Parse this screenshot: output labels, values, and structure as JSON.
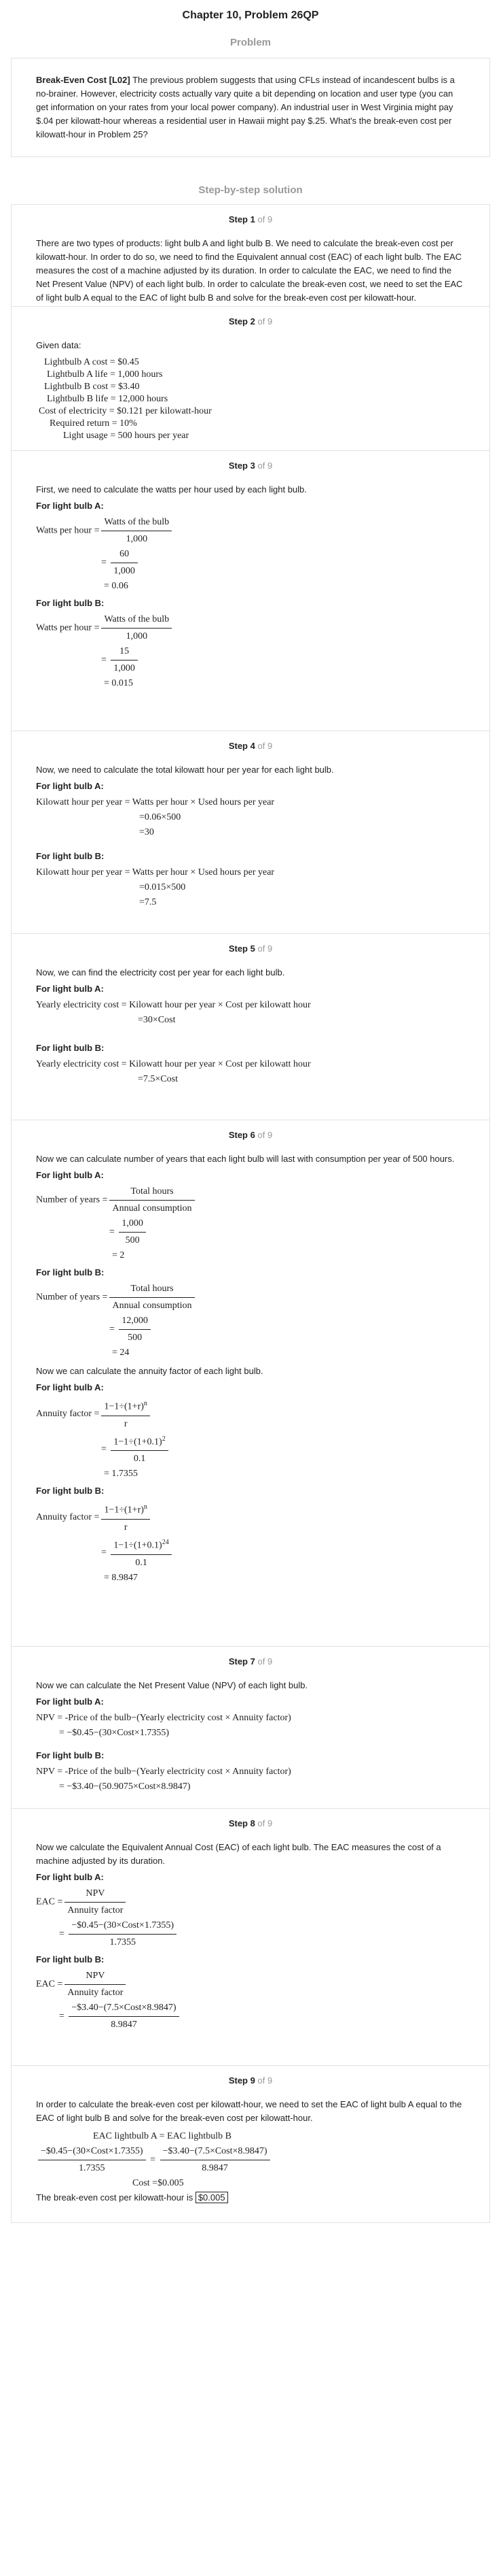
{
  "header": {
    "title": "Chapter 10, Problem 26QP"
  },
  "problem": {
    "section_label": "Problem",
    "bold_lead": "Break-Even Cost [L02]",
    "text": " The previous problem suggests that using CFLs instead of incandescent bulbs is a no-brainer. However, electricity costs actually vary quite a bit depending on location and user type (you can get information on your rates from your local power company). An industrial user in West Virginia might pay $.04 per kilowatt-hour whereas a residential user in Hawaii might pay $.25. What's the break-even cost per kilowatt-hour in Problem 25?"
  },
  "solution": {
    "section_label": "Step-by-step solution"
  },
  "step_word": "Step",
  "step_of": "of 9",
  "light_a": "For light bulb A:",
  "light_b": "For light bulb B:",
  "steps": {
    "s1": {
      "num": "1",
      "text": "There are two types of products: light bulb A and light bulb B. We need to calculate the break-even cost per kilowatt-hour. In order to do so, we need to find the Equivalent annual cost (EAC) of each light bulb. The EAC measures the cost of a machine adjusted by its duration. In order to calculate the EAC, we need to find the Net Present Value (NPV) of each light bulb. In order to calculate the break-even cost, we need to set the EAC of light bulb A equal to the EAC of light bulb B and solve for the break-even cost per kilowatt-hour."
    },
    "s2": {
      "num": "2",
      "intro": "Given data:",
      "rows": [
        "Lightbulb A cost = $0.45",
        "Lightbulb A life = 1,000 hours",
        "Lightbulb B cost = $3.40",
        "Lightbulb B life = 12,000 hours",
        "Cost of electricity = $0.121 per kilowatt-hour",
        "Required return = 10%",
        "Light usage = 500 hours per year"
      ]
    },
    "s3": {
      "num": "3",
      "intro": "First, we need to calculate the watts per hour used by each light bulb.",
      "lhs": "Watts per hour =",
      "num_label": "Watts of the bulb",
      "den_label": "1,000",
      "a_num": "60",
      "a_den": "1,000",
      "a_res": "= 0.06",
      "b_num": "15",
      "b_den": "1,000",
      "b_res": "= 0.015"
    },
    "s4": {
      "num": "4",
      "intro": "Now, we need to calculate the total kilowatt hour per year for each light bulb.",
      "formula": "Kilowatt hour per year = Watts per hour × Used hours per year",
      "a1": "=0.06×500",
      "a2": "=30",
      "b1": "=0.015×500",
      "b2": "=7.5"
    },
    "s5": {
      "num": "5",
      "intro": "Now, we can find the electricity cost per year for each light bulb.",
      "formula": "Yearly electricity cost = Kilowatt hour per year × Cost per kilowatt hour",
      "a1": "=30×Cost",
      "b1": "=7.5×Cost"
    },
    "s6": {
      "num": "6",
      "intro": "Now we can calculate number of years that each light bulb will last with consumption per year of 500 hours.",
      "lhs": "Number of years =",
      "num_label": "Total hours",
      "den_label": "Annual consumption",
      "a_num": "1,000",
      "a_den": "500",
      "a_res": "= 2",
      "b_num": "12,000",
      "b_den": "500",
      "b_res": "= 24",
      "intro2": "Now we can calculate the annuity factor of each light bulb.",
      "af_lhs": "Annuity factor =",
      "af_num": "1−1÷(1+r)",
      "af_exp": "n",
      "af_den": "r",
      "a_af_num": "1−1÷(1+0.1)",
      "a_af_exp": "2",
      "a_af_den": "0.1",
      "a_af_res": "= 1.7355",
      "b_af_num": "1−1÷(1+0.1)",
      "b_af_exp": "24",
      "b_af_den": "0.1",
      "b_af_res": "= 8.9847"
    },
    "s7": {
      "num": "7",
      "intro": "Now we can calculate the Net Present Value (NPV) of each light bulb.",
      "formula": "NPV = -Price of the bulb−(Yearly electricity cost × Annuity factor)",
      "a1": "= −$0.45−(30×Cost×1.7355)",
      "b1": "= −$3.40−(50.9075×Cost×8.9847)"
    },
    "s8": {
      "num": "8",
      "intro": "Now we calculate the Equivalent Annual Cost (EAC) of each light bulb. The EAC measures the cost of a machine adjusted by its duration.",
      "lhs": "EAC =",
      "num_label": "NPV",
      "den_label": "Annuity factor",
      "a_num": "−$0.45−(30×Cost×1.7355)",
      "a_den": "1.7355",
      "b_num": "−$3.40−(7.5×Cost×8.9847)",
      "b_den": "8.9847"
    },
    "s9": {
      "num": "9",
      "intro": "In order to calculate the break-even cost per kilowatt-hour, we need to set the EAC of light bulb A equal to the EAC of light bulb B and solve for the break-even cost per kilowatt-hour.",
      "eq1": "EAC lightbulb A = EAC lightbulb B",
      "l_num": "−$0.45−(30×Cost×1.7355)",
      "l_den": "1.7355",
      "r_num": "−$3.40−(7.5×Cost×8.9847)",
      "r_den": "8.9847",
      "eq3": "Cost =$0.005",
      "answer_text": "The break-even cost per kilowatt-hour is ",
      "answer_value": "$0.005"
    }
  }
}
